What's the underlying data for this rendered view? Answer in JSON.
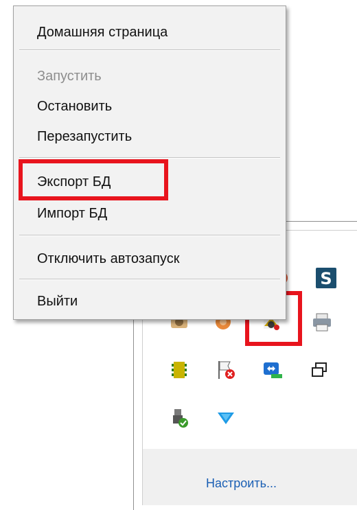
{
  "context_menu": {
    "items": [
      {
        "label": "Домашняя страница",
        "enabled": true
      },
      {
        "label": "Запустить",
        "enabled": false
      },
      {
        "label": "Остановить",
        "enabled": true
      },
      {
        "label": "Перезапустить",
        "enabled": true
      },
      {
        "label": "Экспорт БД",
        "enabled": true,
        "highlighted": true
      },
      {
        "label": "Импорт БД",
        "enabled": true
      },
      {
        "label": "Отключить автозапуск",
        "enabled": true
      },
      {
        "label": "Выйти",
        "enabled": true
      }
    ]
  },
  "tray": {
    "customize_label": "Настроить...",
    "icons": [
      "app-red-icon",
      "s-app-icon",
      "camera-app-icon",
      "orange-app-icon",
      "server-app-icon",
      "printer-icon",
      "memory-chip-icon",
      "action-center-flag-icon",
      "teamviewer-icon",
      "display-copy-icon",
      "safely-remove-hardware-icon",
      "down-arrow-app-icon"
    ]
  },
  "annotation_color": "#e8141d",
  "colors": {
    "menu_background": "#f2f2f2",
    "link": "#1a5fb4",
    "disabled_text": "#8d8d8d"
  }
}
